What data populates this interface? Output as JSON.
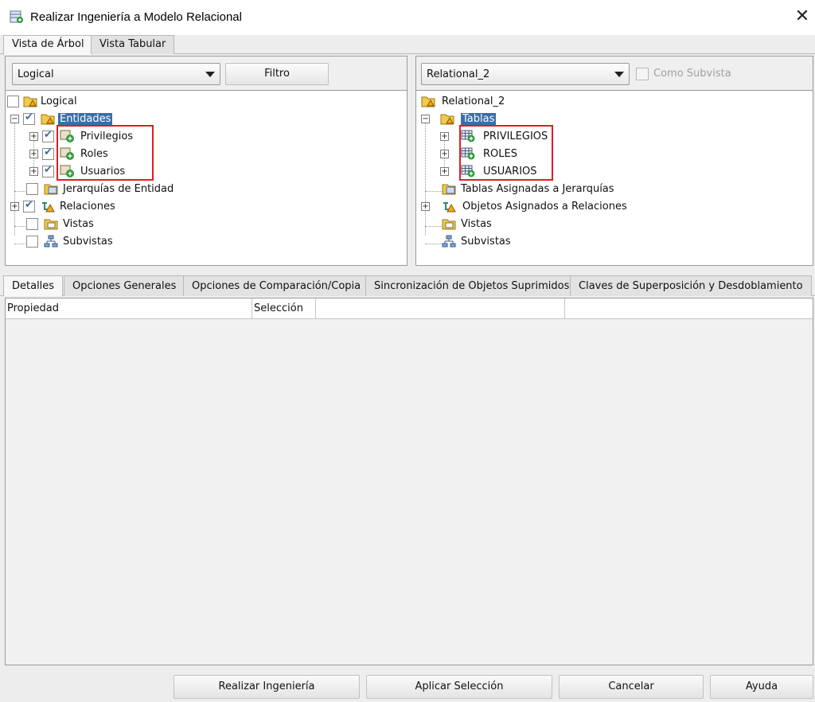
{
  "window": {
    "title": "Realizar Ingeniería a Modelo Relacional",
    "close_glyph": "✕"
  },
  "top_tabs": [
    {
      "label": "Vista de Árbol"
    },
    {
      "label": "Vista Tabular"
    }
  ],
  "left": {
    "combo_value": "Logical",
    "filter_button": "Filtro",
    "tree": {
      "root": "Logical",
      "entidades": "Entidades",
      "children": [
        "Privilegios",
        "Roles",
        "Usuarios"
      ],
      "jerarquias": "Jerarquías de Entidad",
      "relaciones": "Relaciones",
      "vistas": "Vistas",
      "subvistas": "Subvistas"
    }
  },
  "right": {
    "combo_value": "Relational_2",
    "subview_checkbox_label": "Como Subvista",
    "tree": {
      "root": "Relational_2",
      "tablas": "Tablas",
      "children": [
        "PRIVILEGIOS",
        "ROLES",
        "USUARIOS"
      ],
      "tablas_asignadas": "Tablas Asignadas a Jerarquías",
      "objetos_asignados": "Objetos Asignados a Relaciones",
      "vistas": "Vistas",
      "subvistas": "Subvistas"
    }
  },
  "bottom_tabs": [
    {
      "label": "Detalles"
    },
    {
      "label": "Opciones Generales"
    },
    {
      "label": "Opciones de Comparación/Copia"
    },
    {
      "label": "Sincronización de Objetos Suprimidos"
    },
    {
      "label": "Claves de Superposición y Desdoblamiento"
    }
  ],
  "grid": {
    "columns": [
      "Propiedad",
      "Selección",
      "",
      ""
    ]
  },
  "footer": {
    "realizar": "Realizar Ingeniería",
    "aplicar": "Aplicar Selección",
    "cancelar": "Cancelar",
    "ayuda": "Ayuda"
  },
  "colors": {
    "selection": "#3b6ea5",
    "highlight_box": "#e31b23"
  }
}
